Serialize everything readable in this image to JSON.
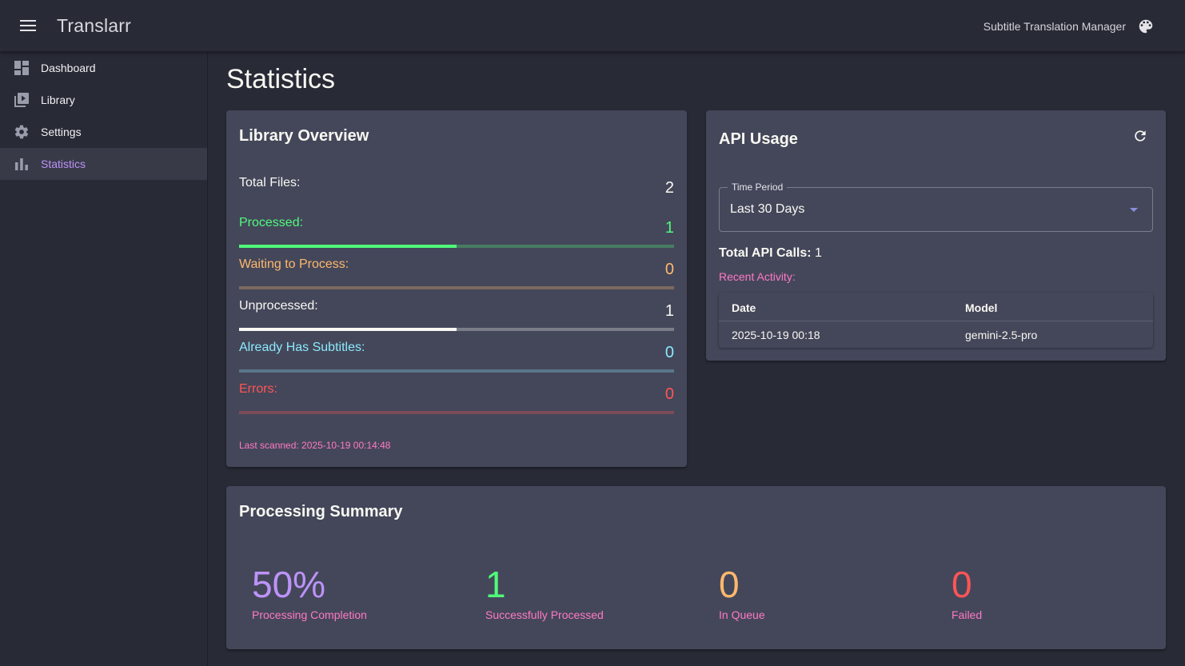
{
  "appbar": {
    "title": "Translarr",
    "subtitle": "Subtitle Translation Manager",
    "menu_icon": "menu-icon",
    "palette_icon": "palette-icon"
  },
  "sidebar": {
    "items": [
      {
        "label": "Dashboard",
        "icon": "dashboard-icon",
        "active": false
      },
      {
        "label": "Library",
        "icon": "video-library-icon",
        "active": false
      },
      {
        "label": "Settings",
        "icon": "gear-icon",
        "active": false
      },
      {
        "label": "Statistics",
        "icon": "bar-chart-icon",
        "active": true
      }
    ]
  },
  "page": {
    "title": "Statistics"
  },
  "library_overview": {
    "title": "Library Overview",
    "total_files": {
      "label": "Total Files:",
      "value": "2"
    },
    "stats": [
      {
        "label": "Processed:",
        "value": "1",
        "color": "#50fa7b",
        "fraction": 0.5
      },
      {
        "label": "Waiting to Process:",
        "value": "0",
        "color": "#ffb86c",
        "fraction": 0
      },
      {
        "label": "Unprocessed:",
        "value": "1",
        "color": "#f8f8f2",
        "fraction": 0.5
      },
      {
        "label": "Already Has Subtitles:",
        "value": "0",
        "color": "#8be9fd",
        "fraction": 0
      },
      {
        "label": "Errors:",
        "value": "0",
        "color": "#ff5555",
        "fraction": 0
      }
    ],
    "last_scanned": "Last scanned: 2025-10-19 00:14:48"
  },
  "api_usage": {
    "title": "API Usage",
    "refresh_icon": "refresh-icon",
    "time_period": {
      "label": "Time Period",
      "value": "Last 30 Days"
    },
    "total_calls_label": "Total API Calls:",
    "total_calls_value": "1",
    "recent_activity_label": "Recent Activity:",
    "table": {
      "columns": [
        "Date",
        "Model"
      ],
      "rows": [
        [
          "2025-10-19 00:18",
          "gemini-2.5-pro"
        ]
      ]
    }
  },
  "processing_summary": {
    "title": "Processing Summary",
    "items": [
      {
        "value": "50%",
        "caption": "Processing Completion",
        "color": "#bd93f9"
      },
      {
        "value": "1",
        "caption": "Successfully Processed",
        "color": "#50fa7b"
      },
      {
        "value": "0",
        "caption": "In Queue",
        "color": "#ffb86c"
      },
      {
        "value": "0",
        "caption": "Failed",
        "color": "#ff5555"
      }
    ]
  },
  "colors": {
    "accent": "#bd93f9",
    "pink": "#ff79c6",
    "background": "#282a36",
    "card": "#44475a"
  }
}
